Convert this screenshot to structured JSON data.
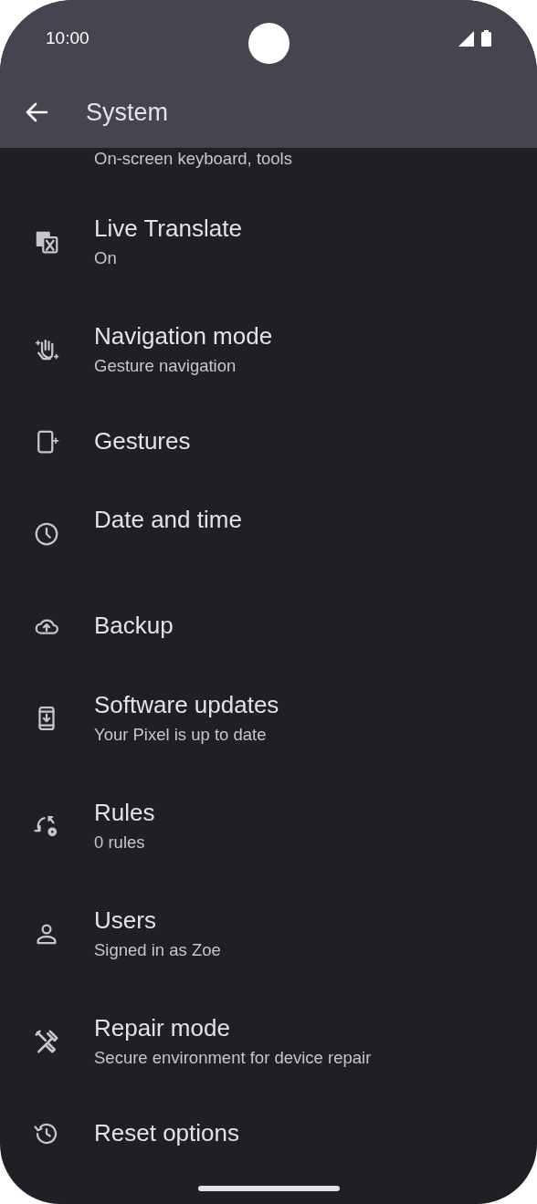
{
  "status_bar": {
    "time": "10:00"
  },
  "toolbar": {
    "title": "System"
  },
  "items": [
    {
      "subtitle": "On-screen keyboard, tools"
    },
    {
      "title": "Live Translate",
      "subtitle": "On"
    },
    {
      "title": "Navigation mode",
      "subtitle": "Gesture navigation"
    },
    {
      "title": "Gestures"
    },
    {
      "title": "Date and time"
    },
    {
      "title": "Backup"
    },
    {
      "title": "Software updates",
      "subtitle": "Your Pixel is up to date"
    },
    {
      "title": "Rules",
      "subtitle": "0 rules"
    },
    {
      "title": "Users",
      "subtitle": "Signed in as Zoe"
    },
    {
      "title": "Repair mode",
      "subtitle": "Secure environment for device repair"
    },
    {
      "title": "Reset options"
    }
  ]
}
